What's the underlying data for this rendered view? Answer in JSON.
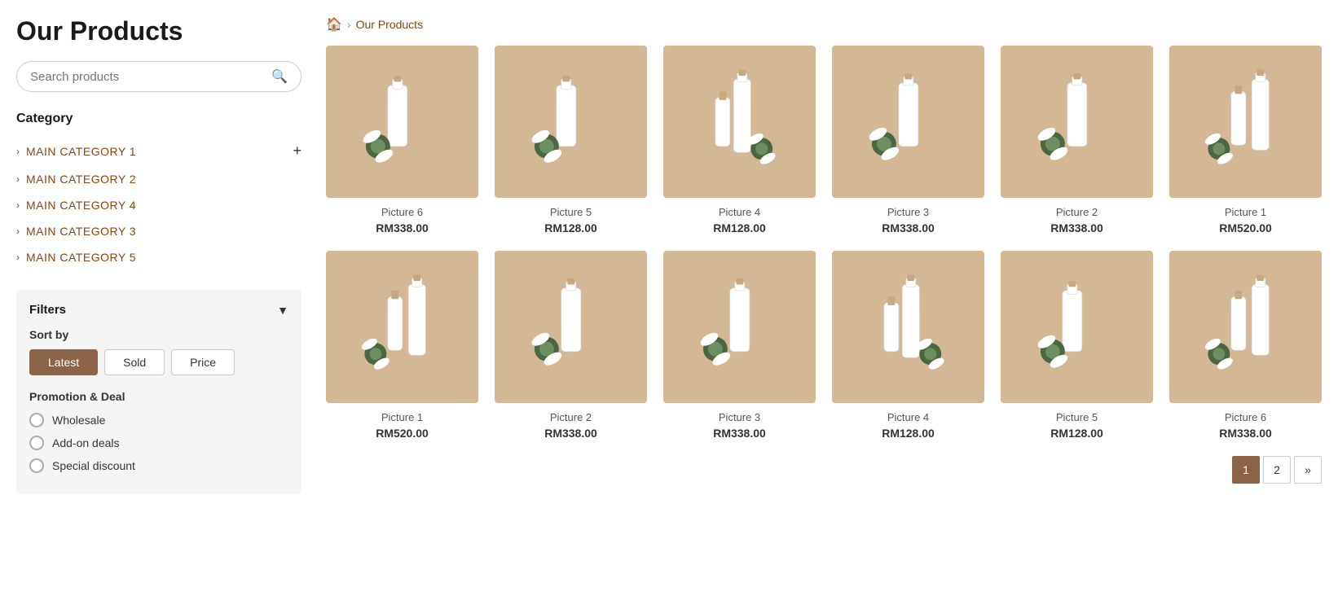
{
  "page": {
    "title": "Our Products"
  },
  "sidebar": {
    "search_placeholder": "Search products",
    "category_title": "Category",
    "categories": [
      {
        "id": "cat1",
        "label": "MAIN CATEGORY 1",
        "has_plus": true
      },
      {
        "id": "cat2",
        "label": "MAIN CATEGORY 2",
        "has_plus": false
      },
      {
        "id": "cat4",
        "label": "MAIN CATEGORY 4",
        "has_plus": false
      },
      {
        "id": "cat3",
        "label": "MAIN CATEGORY 3",
        "has_plus": false
      },
      {
        "id": "cat5",
        "label": "MAIN CATEGORY 5",
        "has_plus": false
      }
    ],
    "filters_title": "Filters",
    "sort_by_label": "Sort by",
    "sort_options": [
      {
        "id": "latest",
        "label": "Latest",
        "active": true
      },
      {
        "id": "sold",
        "label": "Sold",
        "active": false
      },
      {
        "id": "price",
        "label": "Price",
        "active": false
      }
    ],
    "promo_title": "Promotion & Deal",
    "promo_options": [
      {
        "id": "wholesale",
        "label": "Wholesale"
      },
      {
        "id": "addon",
        "label": "Add-on deals"
      },
      {
        "id": "special",
        "label": "Special discount"
      }
    ]
  },
  "breadcrumb": {
    "home_icon": "🏠",
    "separator": ">",
    "current": "Our Products"
  },
  "products_row1": [
    {
      "id": "p6",
      "name": "Picture 6",
      "price": "RM338.00"
    },
    {
      "id": "p5",
      "name": "Picture 5",
      "price": "RM128.00"
    },
    {
      "id": "p4",
      "name": "Picture 4",
      "price": "RM128.00"
    },
    {
      "id": "p3",
      "name": "Picture 3",
      "price": "RM338.00"
    },
    {
      "id": "p2",
      "name": "Picture 2",
      "price": "RM338.00"
    },
    {
      "id": "p1",
      "name": "Picture 1",
      "price": "RM520.00"
    }
  ],
  "products_row2": [
    {
      "id": "p1b",
      "name": "Picture 1",
      "price": "RM520.00"
    },
    {
      "id": "p2b",
      "name": "Picture 2",
      "price": "RM338.00"
    },
    {
      "id": "p3b",
      "name": "Picture 3",
      "price": "RM338.00"
    },
    {
      "id": "p4b",
      "name": "Picture 4",
      "price": "RM128.00"
    },
    {
      "id": "p5b",
      "name": "Picture 5",
      "price": "RM128.00"
    },
    {
      "id": "p6b",
      "name": "Picture 6",
      "price": "RM338.00"
    }
  ],
  "pagination": {
    "pages": [
      "1",
      "2",
      "»"
    ],
    "active_page": "1"
  },
  "colors": {
    "accent": "#8B4513",
    "button_active": "#8B6347",
    "bg_tan": "#D4B896"
  }
}
